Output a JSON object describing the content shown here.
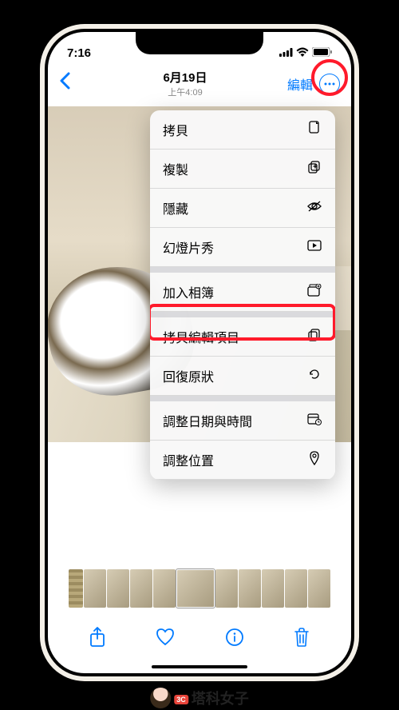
{
  "status": {
    "time": "7:16"
  },
  "nav": {
    "date": "6月19日",
    "time": "上午4:09",
    "edit": "編輯"
  },
  "menu": {
    "copy": "拷貝",
    "duplicate": "複製",
    "hide": "隱藏",
    "slideshow": "幻燈片秀",
    "addToAlbum": "加入相簿",
    "copyEdits": "拷貝編輯項目",
    "revert": "回復原狀",
    "adjustDateTime": "調整日期與時間",
    "adjustLocation": "調整位置"
  },
  "watermark": {
    "badge": "3C",
    "text": "塔科女子"
  }
}
